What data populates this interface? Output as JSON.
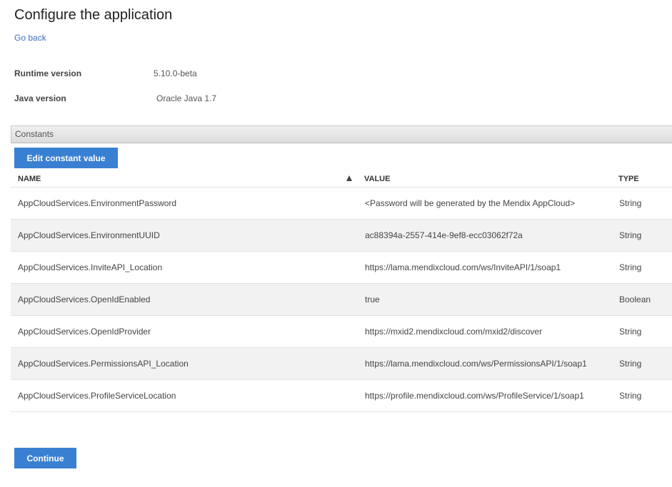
{
  "header": {
    "title": "Configure the application",
    "go_back": "Go back"
  },
  "info": {
    "runtime_label": "Runtime version",
    "runtime_value": "5.10.0-beta",
    "java_label": "Java version",
    "java_value": "Oracle Java 1.7"
  },
  "constants": {
    "section_title": "Constants",
    "edit_button": "Edit constant value",
    "columns": {
      "name": "NAME",
      "value": "VALUE",
      "type": "TYPE"
    },
    "rows": [
      {
        "name": "AppCloudServices.EnvironmentPassword",
        "value": "<Password will be generated by the Mendix AppCloud>",
        "type": "String"
      },
      {
        "name": "AppCloudServices.EnvironmentUUID",
        "value": "ac88394a-2557-414e-9ef8-ecc03062f72a",
        "type": "String"
      },
      {
        "name": "AppCloudServices.InviteAPI_Location",
        "value": "https://lama.mendixcloud.com/ws/InviteAPI/1/soap1",
        "type": "String"
      },
      {
        "name": "AppCloudServices.OpenIdEnabled",
        "value": "true",
        "type": "Boolean"
      },
      {
        "name": "AppCloudServices.OpenIdProvider",
        "value": "https://mxid2.mendixcloud.com/mxid2/discover",
        "type": "String"
      },
      {
        "name": "AppCloudServices.PermissionsAPI_Location",
        "value": "https://lama.mendixcloud.com/ws/PermissionsAPI/1/soap1",
        "type": "String"
      },
      {
        "name": "AppCloudServices.ProfileServiceLocation",
        "value": "https://profile.mendixcloud.com/ws/ProfileService/1/soap1",
        "type": "String"
      }
    ]
  },
  "footer": {
    "continue_button": "Continue"
  },
  "icons": {
    "sort": "sort-ascending-icon"
  },
  "colors": {
    "accent": "#3a80d2",
    "link": "#3a6ec1",
    "row_alt": "#f2f2f2"
  }
}
